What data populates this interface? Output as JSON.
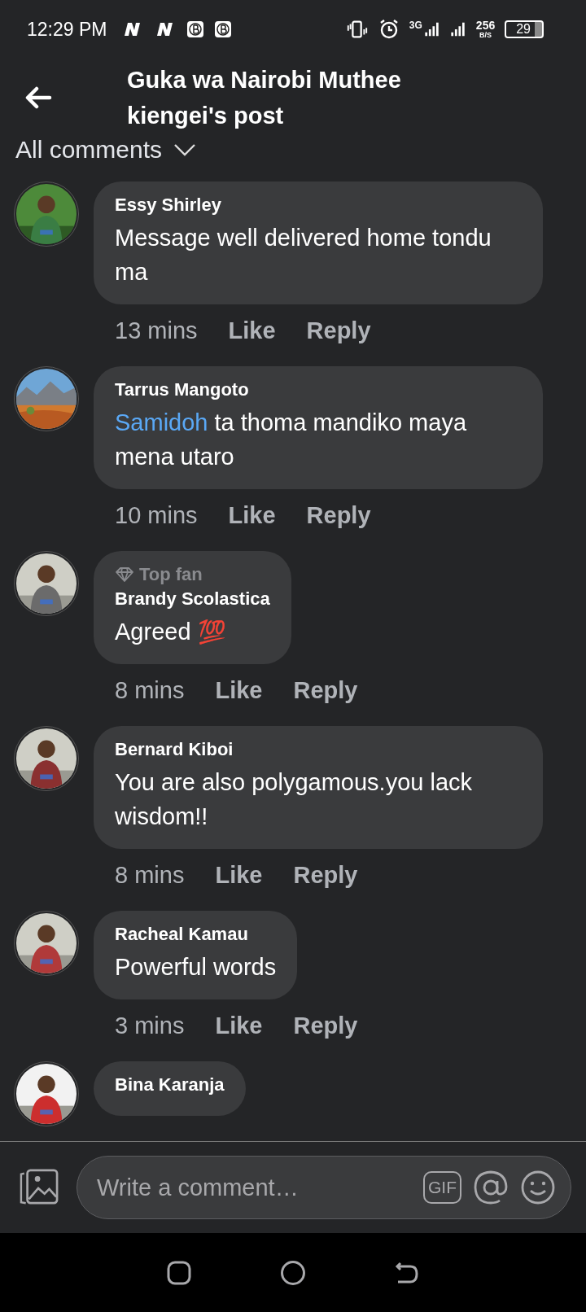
{
  "status_bar": {
    "time": "12:29 PM",
    "network": "3G",
    "speed": "256",
    "speed_unit": "B/S",
    "battery": "29"
  },
  "header": {
    "title": "Guka wa Nairobi Muthee kiengei's post"
  },
  "filter": {
    "label": "All comments"
  },
  "comments": [
    {
      "author": "Essy Shirley",
      "text": "Message well delivered home tondu ma",
      "time": "13 mins",
      "like": "Like",
      "reply": "Reply"
    },
    {
      "author": "Tarrus Mangoto",
      "mention": "Samidoh",
      "text": " ta thoma mandiko maya mena utaro",
      "time": "10 mins",
      "like": "Like",
      "reply": "Reply"
    },
    {
      "author": "Brandy Scolastica",
      "badge": "Top fan",
      "text": "Agreed",
      "emoji": "💯",
      "time": "8 mins",
      "like": "Like",
      "reply": "Reply"
    },
    {
      "author": "Bernard Kiboi",
      "text": "You are also polygamous.you lack wisdom!!",
      "time": "8 mins",
      "like": "Like",
      "reply": "Reply"
    },
    {
      "author": "Racheal Kamau",
      "text": "Powerful words",
      "time": "3 mins",
      "like": "Like",
      "reply": "Reply"
    },
    {
      "author": "Bina Karanja"
    }
  ],
  "composer": {
    "placeholder": "Write a comment…",
    "gif": "GIF"
  }
}
